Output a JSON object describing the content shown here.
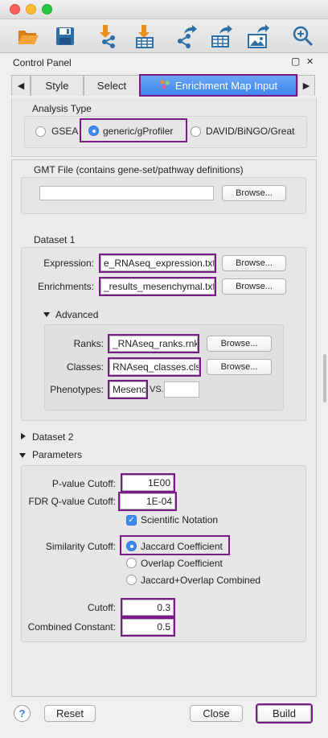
{
  "toolbar": {
    "icons": [
      "open-folder-icon",
      "save-icon",
      "import-network-icon",
      "import-table-icon",
      "export-network-icon",
      "export-table-icon",
      "export-image-icon",
      "zoom-in-icon"
    ]
  },
  "panel": {
    "title": "Control Panel",
    "float_glyph": "▢",
    "close_glyph": "✕"
  },
  "tabs": {
    "prev_glyph": "◀",
    "next_glyph": "▶",
    "items": [
      {
        "label": "Style"
      },
      {
        "label": "Select"
      },
      {
        "label": "Enrichment Map Input"
      }
    ]
  },
  "analysis_type": {
    "heading": "Analysis Type",
    "options": [
      "GSEA",
      "generic/gProfiler",
      "DAVID/BiNGO/Great"
    ],
    "selected": "generic/gProfiler"
  },
  "gmt": {
    "label": "GMT File (contains gene-set/pathway definitions)",
    "value": "",
    "browse": "Browse..."
  },
  "dataset1": {
    "heading": "Dataset 1",
    "expression_label": "Expression:",
    "expression_value": "e_RNAseq_expression.txt",
    "enrichments_label": "Enrichments:",
    "enrichments_value": "_results_mesenchymal.txt",
    "browse": "Browse...",
    "advanced": {
      "heading": "Advanced",
      "ranks_label": "Ranks:",
      "ranks_value": "_RNAseq_ranks.rnk",
      "classes_label": "Classes:",
      "classes_value": "RNAseq_classes.cls",
      "phenotypes_label": "Phenotypes:",
      "phenotype1": "Mesenc",
      "vs": "VS.",
      "phenotype2": ""
    }
  },
  "dataset2": {
    "heading": "Dataset 2"
  },
  "parameters": {
    "heading": "Parameters",
    "pvalue_label": "P-value Cutoff:",
    "pvalue": "1E00",
    "fdr_label": "FDR Q-value Cutoff:",
    "fdr": "1E-04",
    "sci_notation": "Scientific Notation",
    "sci_checked": true,
    "similarity_label": "Similarity Cutoff:",
    "similarity_options": [
      "Jaccard Coefficient",
      "Overlap Coefficient",
      "Jaccard+Overlap Combined"
    ],
    "similarity_selected": "Jaccard Coefficient",
    "cutoff_label": "Cutoff:",
    "cutoff": "0.3",
    "combined_label": "Combined Constant:",
    "combined": "0.5"
  },
  "footer": {
    "help": "?",
    "reset": "Reset",
    "close": "Close",
    "build": "Build"
  },
  "colors": {
    "highlight": "#7a1a88",
    "active_tab": "#4a8ff0",
    "toolbar_orange": "#e8901e",
    "toolbar_blue": "#2f6fa8"
  }
}
